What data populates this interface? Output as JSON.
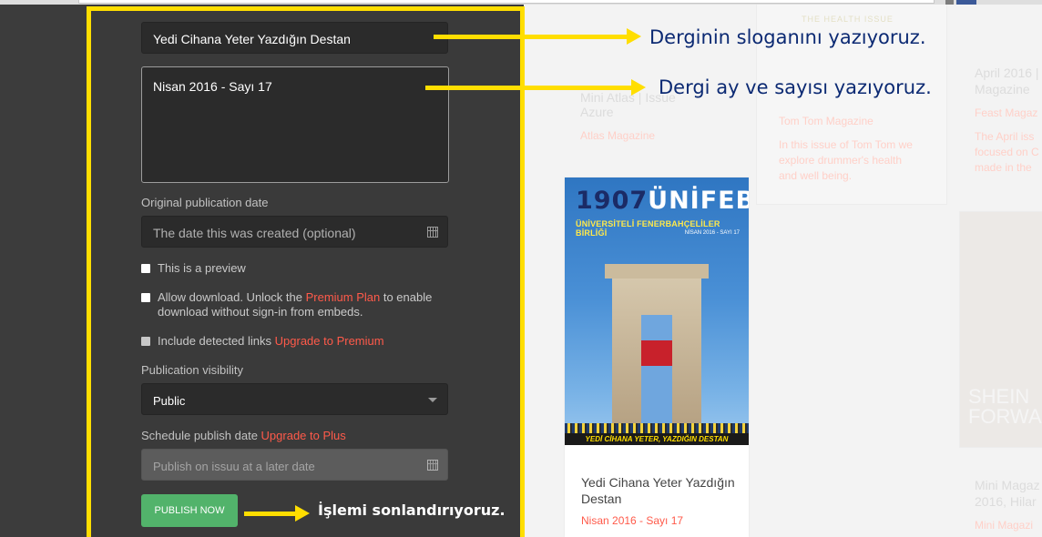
{
  "form": {
    "slogan_value": "Yedi Cihana Yeter Yazdığın Destan",
    "issue_value": "Nisan 2016 - Sayı 17",
    "date_label": "Original publication date",
    "date_placeholder": "The date this was created (optional)",
    "preview_label": "This is a preview",
    "download_label_pre": "Allow download. Unlock the ",
    "download_link": "Premium Plan",
    "download_label_post": " to enable download without sign-in from embeds.",
    "links_label_pre": "Include detected links ",
    "links_link": "Upgrade to Premium",
    "visibility_label": "Publication visibility",
    "visibility_value": "Public",
    "schedule_label_pre": "Schedule publish date ",
    "schedule_link": "Upgrade to Plus",
    "schedule_placeholder": "Publish on issuu at a later date",
    "publish_label": "PUBLISH NOW"
  },
  "annotations": {
    "note1": "Derginin sloganını yazıyoruz.",
    "note2": "Dergi ay ve sayısı yazıyoruz.",
    "note3": "İşlemi sonlandırıyoruz."
  },
  "background": {
    "card1_title": "Mini Atlas | Issue",
    "card1_title2": "Azure",
    "card1_pub": "Atlas Magazine",
    "card2_badge": "THE HEALTH ISSUE",
    "card2_pub": "Tom Tom Magazine",
    "card2_desc1": "In this issue of Tom Tom we",
    "card2_desc2": "explore drummer's health",
    "card2_desc3": "and well being.",
    "card3_title1": "April 2016 |",
    "card3_title2": "Magazine",
    "card3_pub": "Feast Magaz",
    "card3_desc1": "The April iss",
    "card3_desc2": "focused on C",
    "card3_desc3": "made in the",
    "card4_title1": "Mini Magaz",
    "card4_title2": "2016, Hilar",
    "card4_pub": "Mini Magazi",
    "card4_cover_text": "SHEIN FORWA"
  },
  "preview_card": {
    "cover_year": "1907",
    "cover_name": "ÜNİFEB",
    "cover_sub": "ÜNİVERSİTELİ FENERBAHÇELİLER BİRLİĞİ",
    "cover_issue": "NİSAN 2016 - SAYI 17",
    "cover_banner": "YEDİ CİHANA YETER, YAZDIĞIN DESTAN",
    "title": "Yedi Cihana Yeter Yazdığın Destan",
    "issue": "Nisan 2016 - Sayı 17"
  },
  "colors": {
    "accent": "#ffde00",
    "link": "#ff5a4a",
    "publish": "#52b36b",
    "panel": "#3a3a3a"
  }
}
